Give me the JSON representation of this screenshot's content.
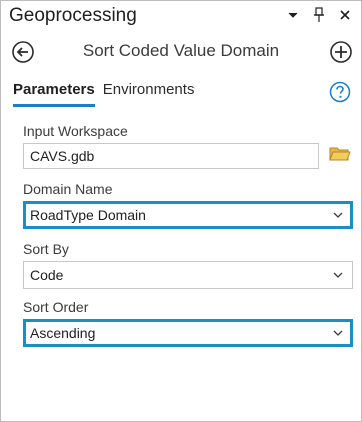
{
  "pane": {
    "title": "Geoprocessing",
    "icons": [
      "chevron-down-icon",
      "pin-icon",
      "close-icon"
    ]
  },
  "tool": {
    "title": "Sort Coded Value Domain",
    "back_icon": "back-arrow-icon",
    "add_icon": "add-icon"
  },
  "tabs": [
    {
      "label": "Parameters",
      "active": true
    },
    {
      "label": "Environments",
      "active": false
    }
  ],
  "help_icon": "help-icon",
  "params": {
    "input_workspace": {
      "label": "Input Workspace",
      "value": "CAVS.gdb",
      "icon": "folder-icon"
    },
    "domain_name": {
      "label": "Domain Name",
      "value": "RoadType Domain"
    },
    "sort_by": {
      "label": "Sort By",
      "value": "Code"
    },
    "sort_order": {
      "label": "Sort Order",
      "value": "Ascending"
    }
  },
  "colors": {
    "accent": "#1a7ec8",
    "highlight_border": "#1a8fc1",
    "folder": "#e8b83c"
  }
}
